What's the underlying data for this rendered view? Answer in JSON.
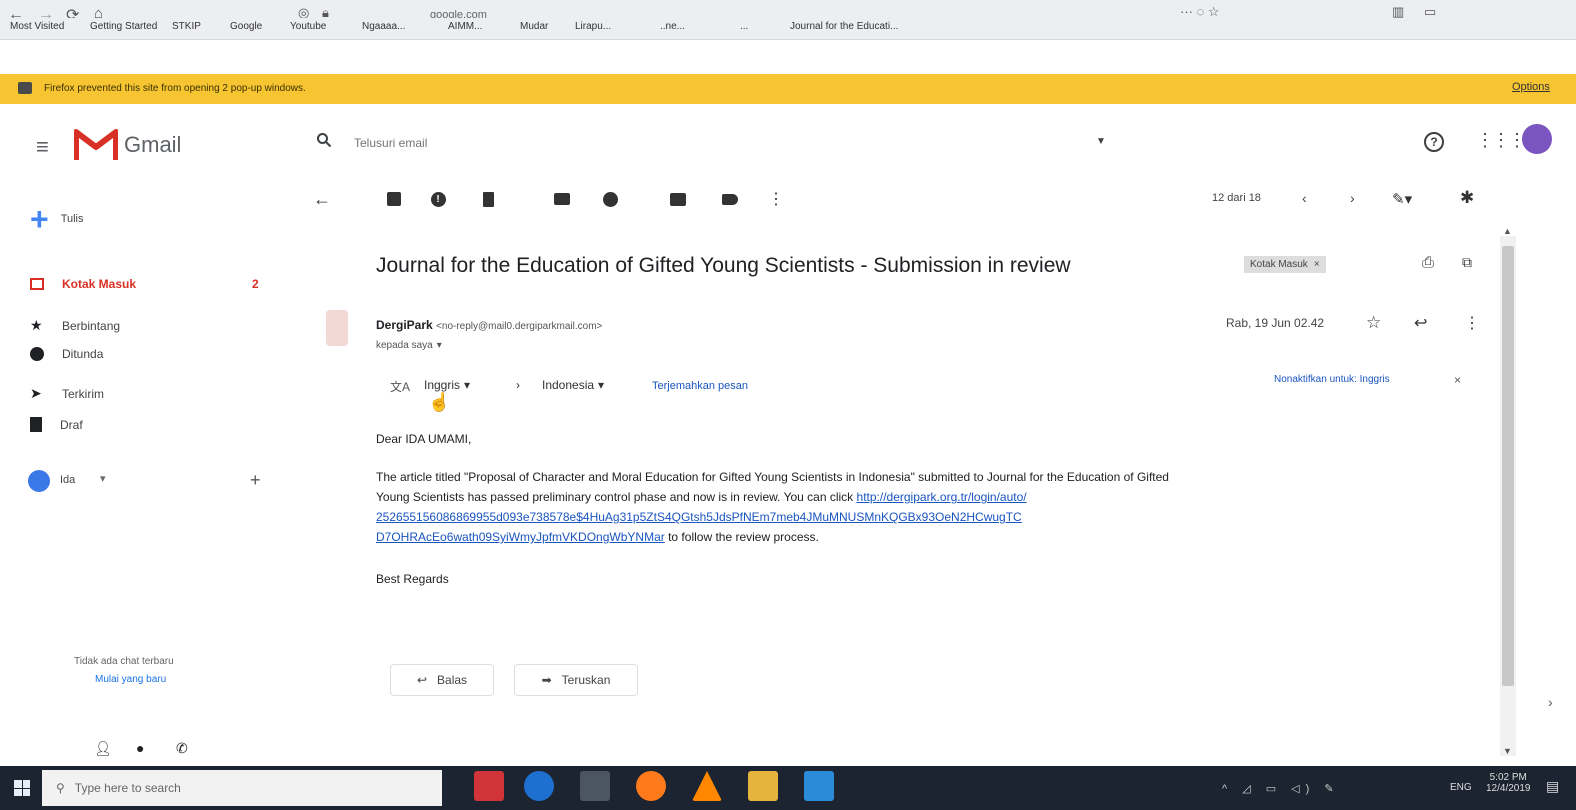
{
  "browser": {
    "url": "google.com",
    "bookmarks": [
      "Most Visited",
      "Getting Started",
      "STKIP",
      "Google",
      "Youtube",
      "Ngaaaa...",
      "AIMM...",
      "Mudar",
      "Lirapu...",
      "..ne...",
      "...",
      "Journal for the Educati..."
    ],
    "popup_notice": "Firefox prevented this site from opening 2 pop-up windows.",
    "options_label": "Options"
  },
  "gmail": {
    "logo_text": "Gmail",
    "search_placeholder": "Telusuri email",
    "compose_label": "Tulis",
    "sidebar": {
      "items": [
        {
          "label": "Kotak Masuk",
          "count": "2"
        },
        {
          "label": "Berbintang"
        },
        {
          "label": "Ditunda"
        },
        {
          "label": "Terkirim"
        },
        {
          "label": "Draf"
        }
      ],
      "account": "Ida",
      "no_chats": "Tidak ada chat terbaru",
      "start_new": "Mulai yang baru"
    },
    "toolbar": {
      "pager": "12 dari 18"
    },
    "email": {
      "subject": "Journal for the Education of Gifted Young Scientists - Submission in review",
      "label_chip": "Kotak Masuk",
      "sender_name": "DergiPark",
      "sender_email": "<no-reply@mail0.dergiparkmail.com>",
      "recipient": "kepada saya",
      "date": "Rab, 19 Jun 02.42",
      "translate": {
        "from": "Inggris",
        "to": "Indonesia",
        "action": "Terjemahkan pesan",
        "disable": "Nonaktifkan untuk: Inggris"
      },
      "greeting": "Dear IDA UMAMI,",
      "body_1": "The article titled \"Proposal of Character and Moral Education for Gifted Young Scientists in Indonesia\" submitted to Journal for the Education of Gifted",
      "body_2": "Young Scientists has passed preliminary control phase and now is in review. You can click",
      "link_1": "http://dergipark.org.tr/login/auto/",
      "link_2": "252655156086869955d093e738578e$4HuAg31p5ZtS4QGtsh5JdsPfNEm7meb4JMuMNUSMnKQGBx93OeN2HCwugTC",
      "link_3": "D7OHRAcEo6wath09SyiWmyJpfmVKDOngWbYNMar",
      "body_3": "to follow the review process.",
      "signoff": "Best Regards",
      "reply_label": "Balas",
      "forward_label": "Teruskan"
    }
  },
  "taskbar": {
    "search_placeholder": "Type here to search",
    "lang": "ENG",
    "time": "5:02 PM",
    "date": "12/4/2019"
  }
}
